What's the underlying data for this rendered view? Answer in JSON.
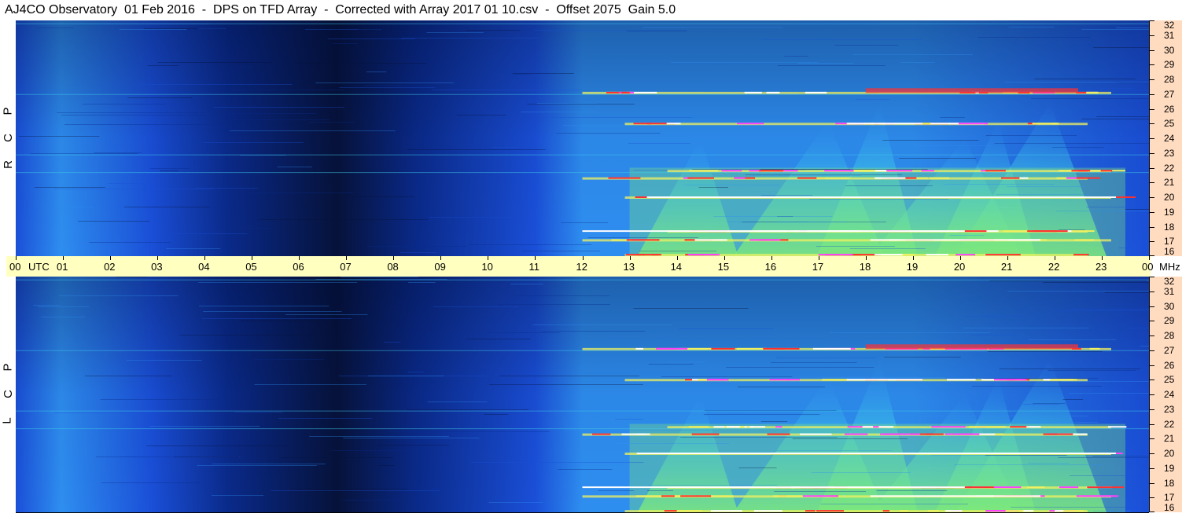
{
  "header": {
    "title": "AJ4CO Observatory  01 Feb 2016  -  DPS on TFD Array  -  Corrected with Array 2017 01 10.csv  -  Offset 2075  Gain 5.0"
  },
  "panels": [
    {
      "id": "rcp",
      "letters": [
        "P",
        "C",
        "R"
      ]
    },
    {
      "id": "lcp",
      "letters": [
        "P",
        "C",
        "L"
      ]
    }
  ],
  "chart_data": {
    "type": "heatmap",
    "title": "AJ4CO Observatory  01 Feb 2016  -  DPS on TFD Array  -  Corrected with Array 2017 01 10.csv  -  Offset 2075  Gain 5.0",
    "x_axis": {
      "unit_label": "UTC",
      "ticks": [
        "00",
        "01",
        "02",
        "03",
        "04",
        "05",
        "06",
        "07",
        "08",
        "09",
        "10",
        "11",
        "12",
        "13",
        "14",
        "15",
        "16",
        "17",
        "18",
        "19",
        "20",
        "21",
        "22",
        "23",
        "00"
      ],
      "range_hours": [
        0,
        24
      ]
    },
    "y_axis": {
      "unit_label": "MHz",
      "ticks": [
        "32",
        "31",
        "30",
        "29",
        "28",
        "27",
        "26",
        "25",
        "24",
        "23",
        "22",
        "21",
        "20",
        "19",
        "18",
        "17",
        "16"
      ],
      "range_mhz": [
        16,
        32
      ]
    },
    "series": [
      {
        "name": "R C P"
      },
      {
        "name": "L C P"
      }
    ],
    "colormap": [
      "#06123a",
      "#0a2a8a",
      "#1a4fd8",
      "#2e8ef0",
      "#3ec8e8",
      "#7de87a",
      "#f0f060",
      "#ff3030",
      "#ff40ff",
      "#ffffff"
    ],
    "features": {
      "dark_region_utc": [
        4.5,
        8.5
      ],
      "bright_region_utc": [
        12,
        24
      ],
      "interference_bands_mhz": [
        27.1,
        25.0,
        21.8,
        21.3,
        20.0,
        17.7,
        17.1,
        16.1
      ],
      "tower_peaks_utc": [
        14.5,
        17.2,
        18.3,
        20.1,
        20.8,
        21.9
      ]
    }
  },
  "colors": {
    "axis_bg": "#ffdcc0",
    "timebar_bg": "#ffffc0"
  }
}
